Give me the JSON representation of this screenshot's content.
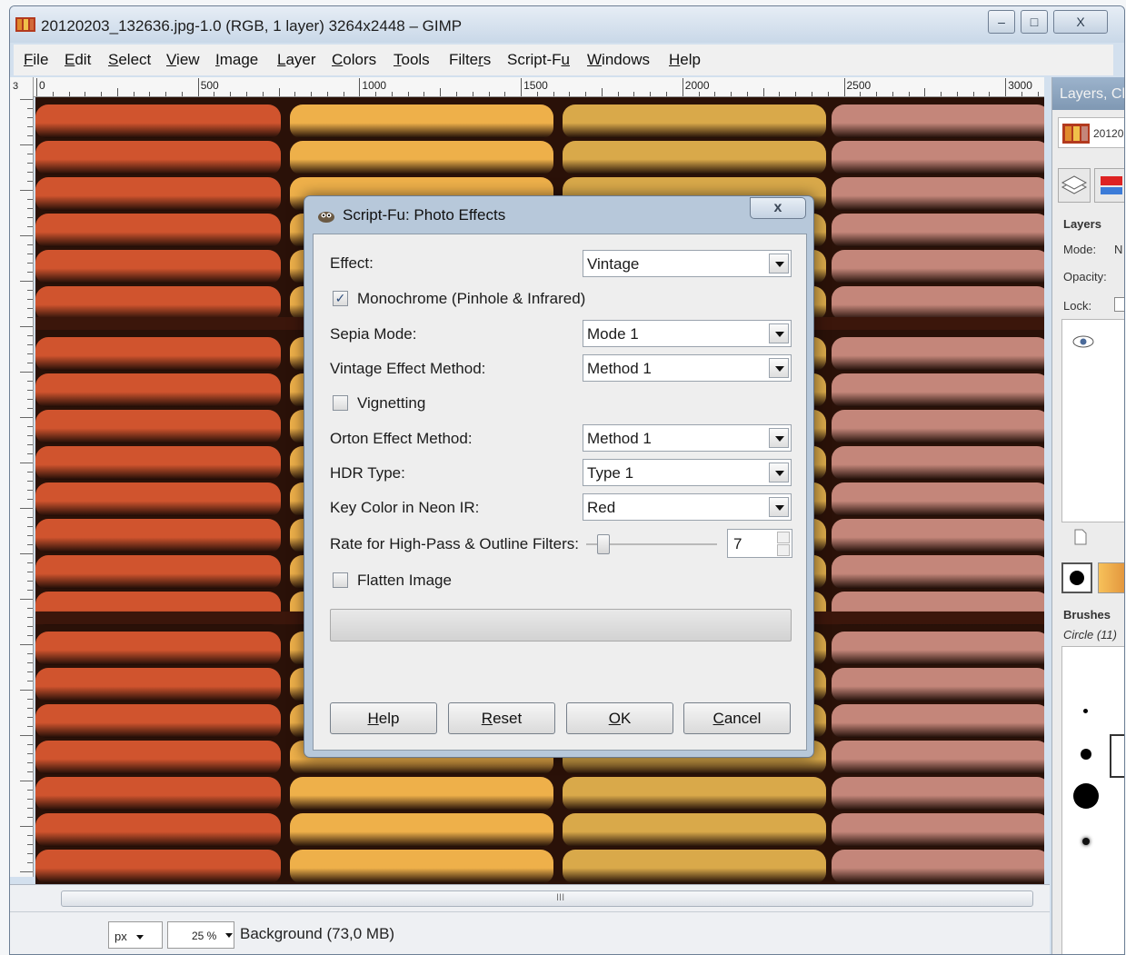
{
  "window": {
    "title": "20120203_132636.jpg-1.0 (RGB, 1 layer) 3264x2448 – GIMP",
    "min_glyph": "–",
    "max_glyph": "□",
    "close_glyph": "X"
  },
  "menu": [
    {
      "pre": "",
      "u": "F",
      "post": "ile"
    },
    {
      "pre": "",
      "u": "E",
      "post": "dit"
    },
    {
      "pre": "",
      "u": "S",
      "post": "elect"
    },
    {
      "pre": "",
      "u": "V",
      "post": "iew"
    },
    {
      "pre": "",
      "u": "I",
      "post": "mage"
    },
    {
      "pre": "",
      "u": "L",
      "post": "ayer"
    },
    {
      "pre": "",
      "u": "C",
      "post": "olors"
    },
    {
      "pre": "",
      "u": "T",
      "post": "ools"
    },
    {
      "pre": "Filte",
      "u": "r",
      "post": "s"
    },
    {
      "pre": "Script-F",
      "u": "u",
      "post": ""
    },
    {
      "pre": "",
      "u": "W",
      "post": "indows"
    },
    {
      "pre": "",
      "u": "H",
      "post": "elp"
    }
  ],
  "ruler": {
    "labels": [
      "0",
      "500",
      "1000",
      "1500",
      "2000",
      "2500",
      "3000"
    ],
    "corner_glyph": "3"
  },
  "dialog": {
    "title": "Script-Fu: Photo Effects",
    "close_glyph": "x",
    "effect_label": "Effect:",
    "effect_value": "Vintage",
    "monochrome_label": "Monochrome (Pinhole & Infrared)",
    "monochrome_checked": true,
    "sepia_label": "Sepia Mode:",
    "sepia_value": "Mode 1",
    "vintage_label": "Vintage Effect Method:",
    "vintage_value": "Method 1",
    "vignetting_label": "Vignetting",
    "vignetting_checked": false,
    "orton_label": "Orton Effect Method:",
    "orton_value": "Method 1",
    "hdr_label": "HDR Type:",
    "hdr_value": "Type 1",
    "neon_label": "Key Color in Neon IR:",
    "neon_value": "Red",
    "rate_label": "Rate for High-Pass & Outline Filters:",
    "rate_value": "7",
    "flatten_label": "Flatten Image",
    "flatten_checked": false,
    "check_glyph": "✓",
    "buttons": {
      "help": {
        "pre": "",
        "u": "H",
        "post": "elp"
      },
      "reset": {
        "pre": "",
        "u": "R",
        "post": "eset"
      },
      "ok": {
        "pre": "",
        "u": "O",
        "post": "K"
      },
      "cancel": {
        "pre": "",
        "u": "C",
        "post": "ancel"
      }
    }
  },
  "status": {
    "unit": "px",
    "zoom": "25 %",
    "info": "Background (73,0 MB)",
    "scroll_grip": "III"
  },
  "dock": {
    "title": "Layers, Ch",
    "image_name": "20120",
    "layers_heading": "Layers",
    "mode_label": "Mode:",
    "mode_value": "N",
    "opacity_label": "Opacity:",
    "lock_label": "Lock:",
    "brushes_heading": "Brushes",
    "brush_name": "Circle (11)"
  },
  "colors": {
    "orange": "#d0542e",
    "yellow": "#eeb04a",
    "gold": "#d9a94a",
    "pink": "#c4867a"
  }
}
